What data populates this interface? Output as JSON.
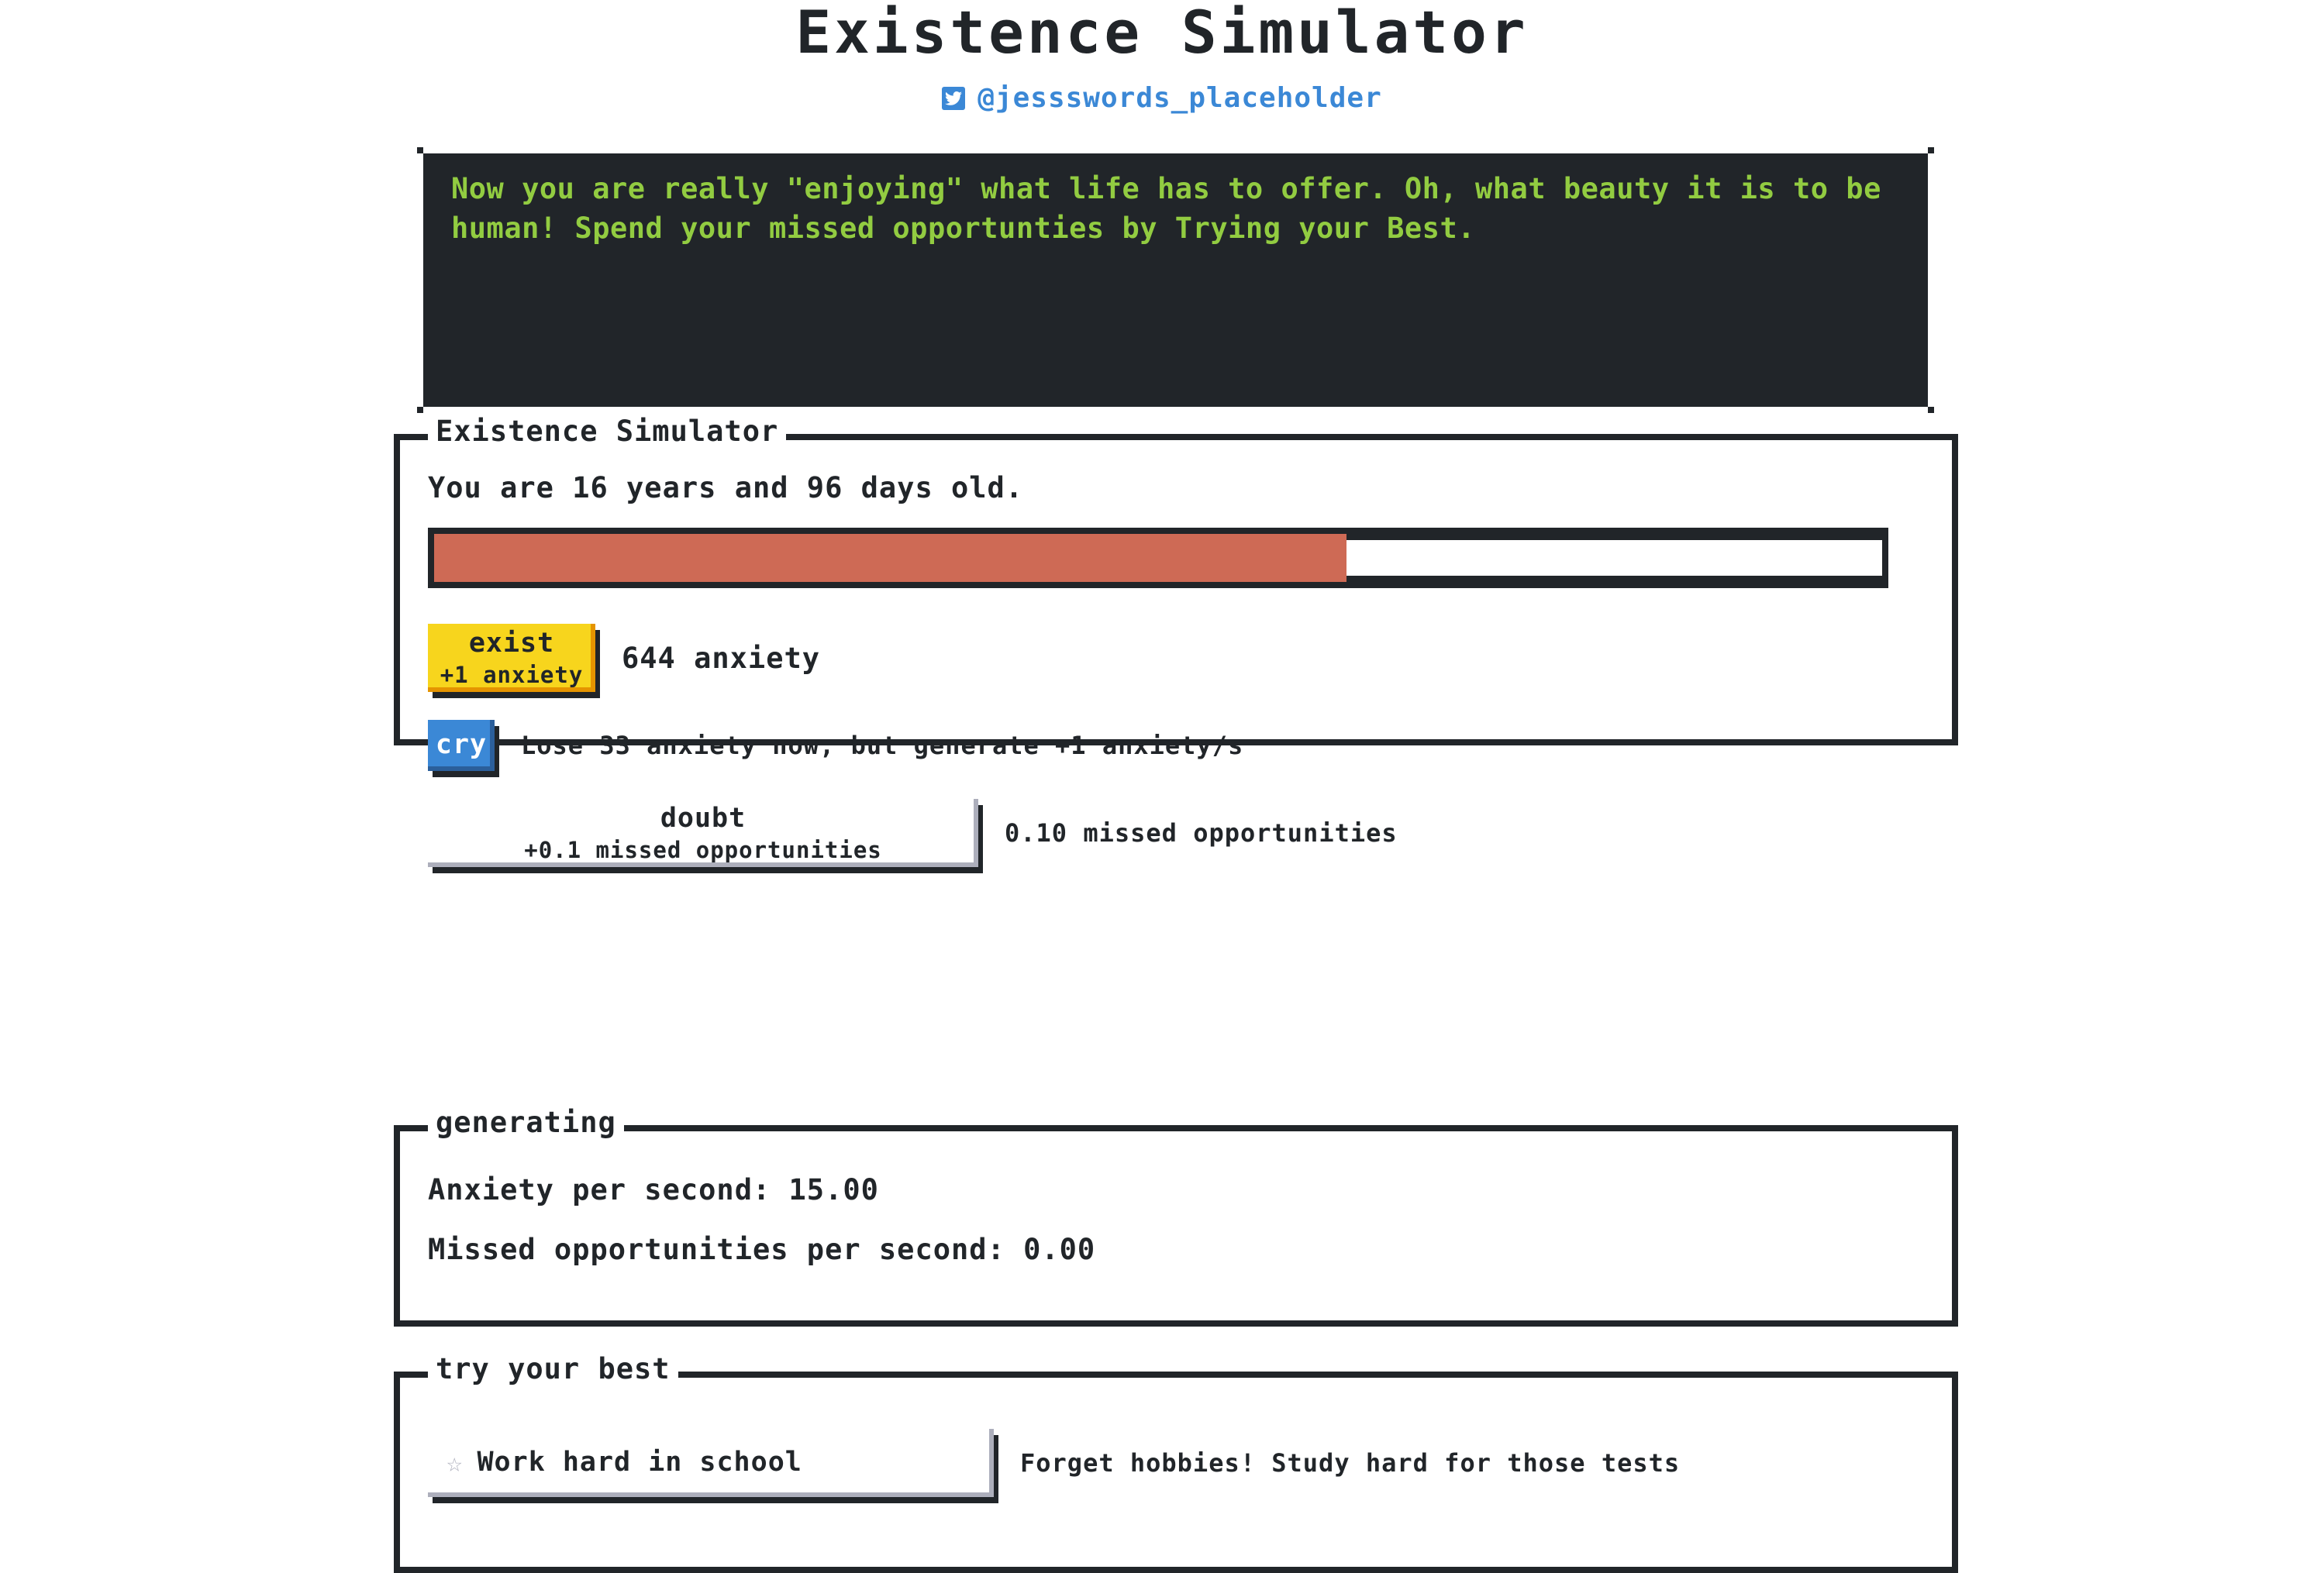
{
  "header": {
    "title": "Existence Simulator",
    "twitter_icon": "twitter-bird-icon",
    "handle": "@jessswords_placeholder"
  },
  "message_box": {
    "text": "Now you are really \"enjoying\" what life has to offer. Oh, what beauty it is to be human! Spend your missed opportunties by Trying your Best.",
    "bg_color": "#212529",
    "text_color": "#92cc41"
  },
  "main_panel": {
    "legend": "Existence Simulator",
    "age_line": "You are 16 years and 96 days old.",
    "progress": {
      "percent": 63,
      "fill_color": "#ce6a55"
    },
    "actions": [
      {
        "id": "exist",
        "label": "exist",
        "sublabel": "+1 anxiety",
        "side_text": "644 anxiety",
        "style": "warning"
      },
      {
        "id": "cry",
        "label": "cry",
        "sublabel": "",
        "side_text": "Lose 33 anxiety now, but generate +1 anxiety/s",
        "style": "primary"
      },
      {
        "id": "doubt",
        "label": "doubt",
        "sublabel": "+0.1 missed opportunities",
        "side_text": "0.10 missed opportunities",
        "style": "default"
      }
    ]
  },
  "generating_panel": {
    "legend": "generating",
    "lines": [
      "Anxiety per second: 15.00",
      "Missed opportunities per second: 0.00"
    ]
  },
  "best_panel": {
    "legend": "try your best",
    "upgrade": {
      "star_icon": "star-outline-icon",
      "label": "Work hard in school",
      "side_text": "Forget hobbies! Study hard for those tests"
    }
  }
}
